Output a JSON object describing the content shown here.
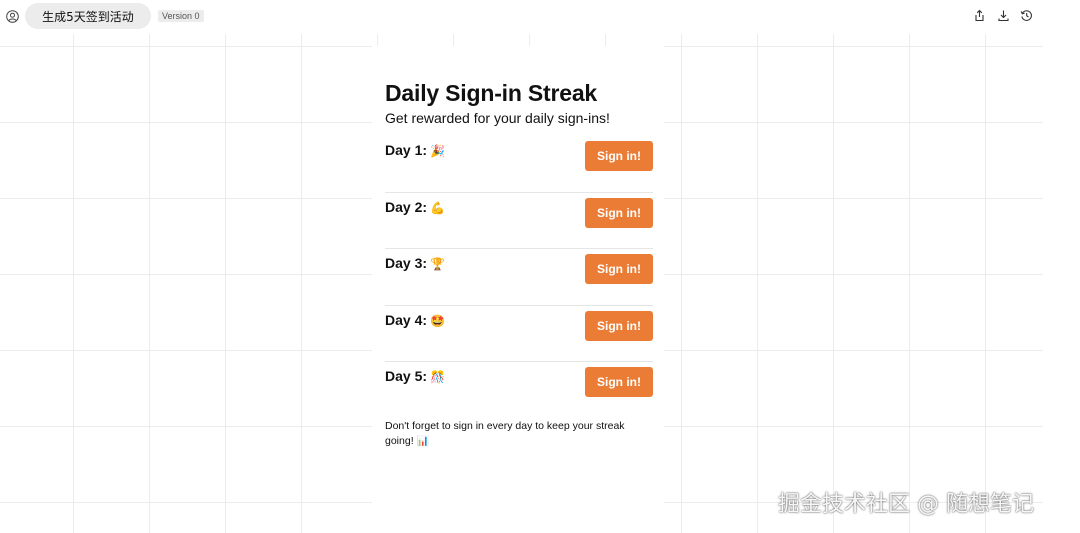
{
  "topbar": {
    "title": "生成5天签到活动",
    "version": "Version 0",
    "icons": [
      "user-icon",
      "share-icon",
      "download-icon",
      "history-icon"
    ]
  },
  "card": {
    "title": "Daily Sign-in Streak",
    "subtitle": "Get rewarded for your daily sign-ins!",
    "days": [
      {
        "label": "Day 1:",
        "emoji": "🎉",
        "button": "Sign in!"
      },
      {
        "label": "Day 2:",
        "emoji": "💪",
        "button": "Sign in!"
      },
      {
        "label": "Day 3:",
        "emoji": "🏆",
        "button": "Sign in!"
      },
      {
        "label": "Day 4:",
        "emoji": "🤩",
        "button": "Sign in!"
      },
      {
        "label": "Day 5:",
        "emoji": "🎊",
        "button": "Sign in!"
      }
    ],
    "footnote": "Don't forget to sign in every day to keep your streak going!",
    "footnote_emoji": "📊"
  },
  "watermark": "掘金技术社区 @ 随想笔记",
  "colors": {
    "accent": "#ea7c35",
    "pill_bg": "#ececec",
    "grid": "#ececec"
  }
}
